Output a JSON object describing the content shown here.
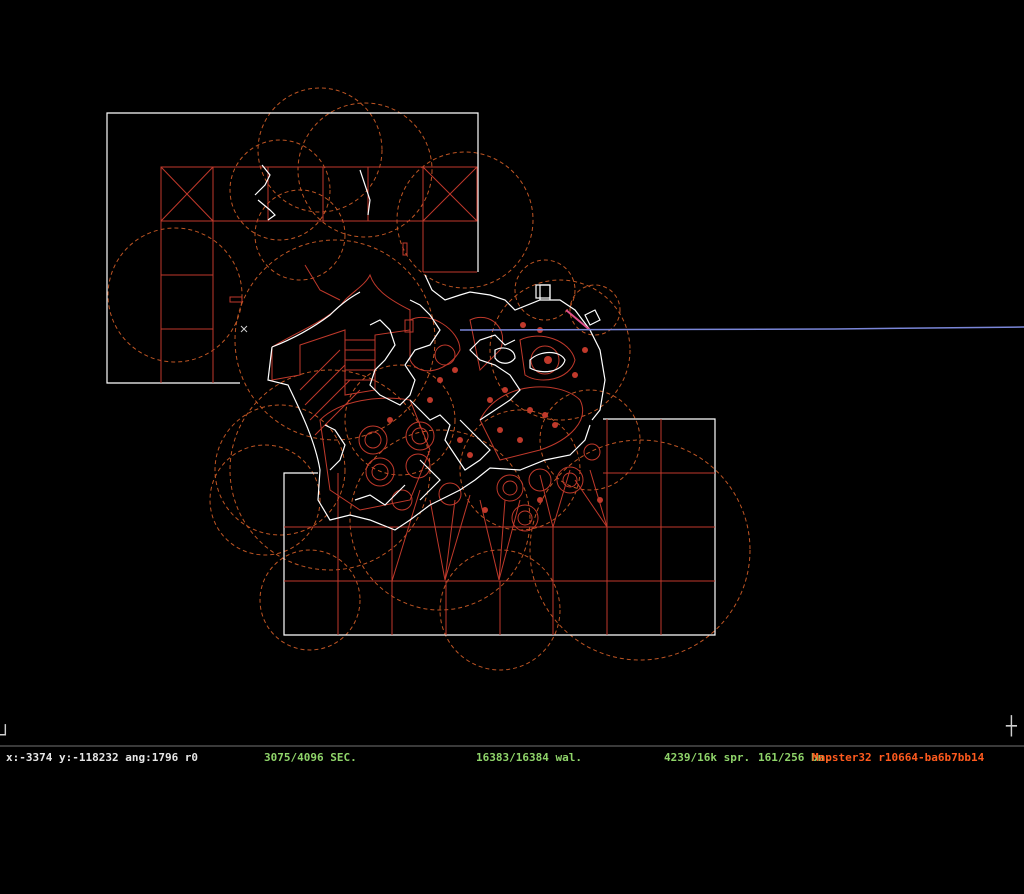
{
  "colors": {
    "background": "#000000",
    "sector_wall": "#c0392b",
    "white_wall": "#ffffff",
    "sprite_circle": "#e0642a",
    "pointer_line": "#7a86d8",
    "status_text": "#e6e6e6",
    "status_counts": "#8fd46a",
    "version_text": "#ff5a1e"
  },
  "status": {
    "position": "x:-3374 y:-118232 ang:1796 r0",
    "sectors": "3075/4096 SEC.",
    "walls": "16383/16384 wal.",
    "sprites": "4239/16k spr.",
    "bunches": "161/256 bn.",
    "version": "Mapster32 r10664-ba6b7bb14"
  },
  "icons": {
    "corner_top_left": "crosshair-corner-icon",
    "corner_bottom_left": "crosshair-corner-icon",
    "corner_bottom_right": "crosshair-corner-icon"
  }
}
